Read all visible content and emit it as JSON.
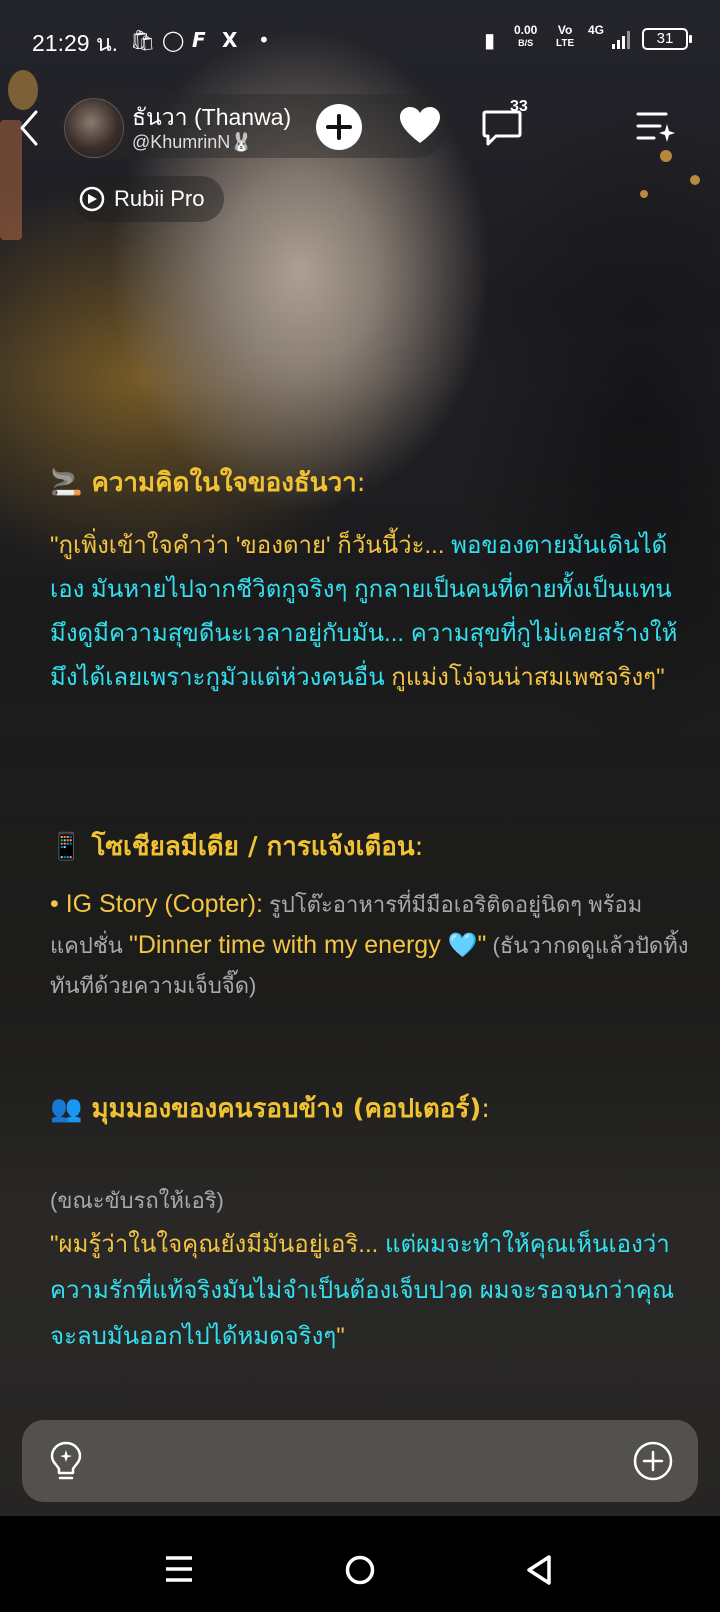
{
  "status_bar": {
    "time": "21:29 น.",
    "net_speed_value": "0.00",
    "net_speed_unit": "B/S",
    "volte_top": "Vo",
    "volte_bottom": "LTE",
    "network": "4G",
    "battery": "31"
  },
  "header": {
    "name": "ธันวา (Thanwa)",
    "handle": "@KhumrinN🐰",
    "comment_count": "33",
    "badge_label": "Rubii Pro"
  },
  "sections": {
    "thoughts": {
      "emoji": "🚬",
      "title": "ความคิดในใจของธันวา",
      "colon": ":",
      "line1_yellow": "\"กูเพิ่งเข้าใจคำว่า 'ของตาย' ก็วันนี้ว่ะ... ",
      "line1_cyan": "พอของตายมันเดินได้เอง มันหายไปจากชีวิตกูจริงๆ กูกลายเป็นคนที่ตายทั้งเป็นแทน มึงดูมีความสุขดีนะเวลาอยู่กับมัน... ความสุขที่กูไม่เคยสร้างให้มึงได้เลยเพราะกูมัวแต่ห่วงคนอื่น ",
      "line1_yellow_end": "กูแม่งโง่จนน่าสมเพชจริงๆ\""
    },
    "social": {
      "emoji": "📱",
      "title": "โซเชียลมีเดีย / การแจ้งเตือน",
      "colon": ":",
      "bullet": "• IG Story (Copter):",
      "desc": " รูปโต๊ะอาหารที่มีมือเอริติดอยู่นิดๆ พร้อมแคปชั่น ",
      "caption_open": "\"Dinner time with my energy ",
      "heart": "🩵",
      "caption_close": "\"",
      "after": " (ธันวากดดูแล้วปัดทิ้งทันทีด้วยความเจ็บจี๊ด)"
    },
    "people": {
      "emoji": "👥",
      "title": "มุมมองของคนรอบข้าง (คอปเตอร์)",
      "colon": ":",
      "action": "(ขณะขับรถให้เอริ)",
      "quote_yellow": "\"ผมรู้ว่าในใจคุณยังมีมันอยู่เอริ... ",
      "quote_cyan": "แต่ผมจะทำให้คุณเห็นเองว่า ความรักที่แท้จริงมันไม่จำเป็นต้องเจ็บปวด ผมจะรอจนกว่าคุณจะลบมันออกไปได้หมดจริงๆ",
      "quote_yellow_end": "\""
    }
  },
  "input": {
    "placeholder": ""
  },
  "colors": {
    "yellow": "#f4c542",
    "cyan": "#33e0f0",
    "grey": "#a9a9a9"
  }
}
